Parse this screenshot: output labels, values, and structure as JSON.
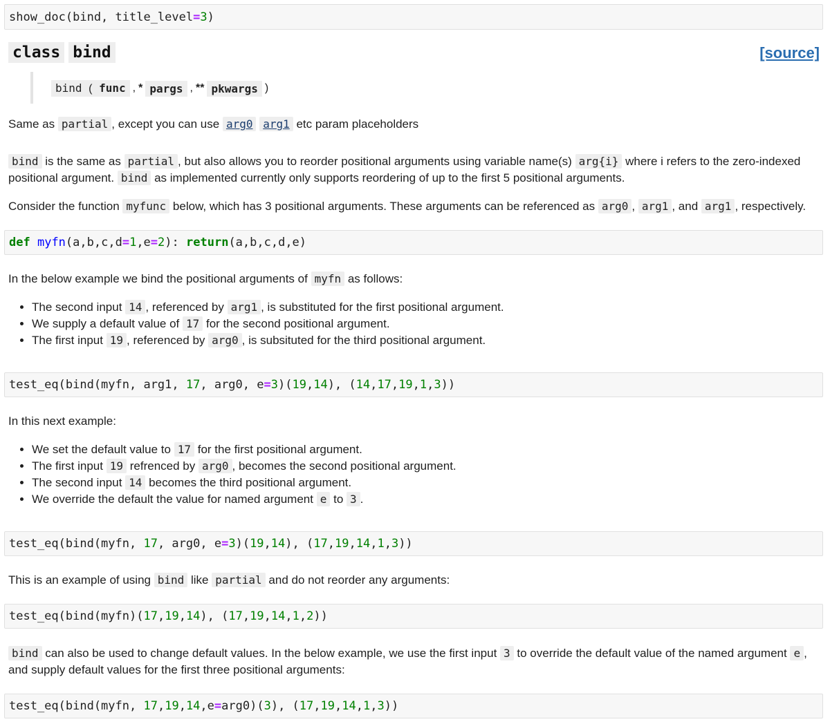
{
  "cells": {
    "show_doc": [
      "show_doc(bind, title_level",
      "=",
      "3",
      ")"
    ],
    "myfn_def": [
      "def",
      " ",
      "myfn",
      "(a,b,c,d",
      "=",
      "1",
      ",e",
      "=",
      "2",
      "): ",
      "return",
      "(a,b,c,d,e)"
    ],
    "test1": [
      "test_eq(bind(myfn, arg1, ",
      "17",
      ", arg0, e",
      "=",
      "3",
      ")(",
      "19",
      ",",
      "14",
      "), (",
      "14",
      ",",
      "17",
      ",",
      "19",
      ",",
      "1",
      ",",
      "3",
      "))"
    ],
    "test2": [
      "test_eq(bind(myfn, ",
      "17",
      ", arg0, e",
      "=",
      "3",
      ")(",
      "19",
      ",",
      "14",
      "), (",
      "17",
      ",",
      "19",
      ",",
      "14",
      ",",
      "1",
      ",",
      "3",
      "))"
    ],
    "test3": [
      "test_eq(bind(myfn)(",
      "17",
      ",",
      "19",
      ",",
      "14",
      "), (",
      "17",
      ",",
      "19",
      ",",
      "14",
      ",",
      "1",
      ",",
      "2",
      "))"
    ],
    "test4": [
      "test_eq(bind(myfn, ",
      "17",
      ",",
      "19",
      ",",
      "14",
      ",e",
      "=",
      "arg0)(",
      "3",
      "), (",
      "17",
      ",",
      "19",
      ",",
      "14",
      ",",
      "1",
      ",",
      "3",
      "))"
    ]
  },
  "heading": {
    "kw": "class",
    "name": "bind",
    "source_label": "[source]"
  },
  "signature": {
    "name": "bind",
    "open": "(",
    "p1": "func",
    "comma": ",",
    "star1": "*",
    "p2": "pargs",
    "star2": "**",
    "p3": "pkwargs",
    "close": ")"
  },
  "p1": {
    "t1": "Same as",
    "c1": "partial",
    "t2": ", except you can use",
    "c2": "arg0",
    "c3": "arg1",
    "t3": "etc param placeholders"
  },
  "p2": {
    "c1": "bind",
    "t1": "is the same as",
    "c2": "partial",
    "t2": ", but also allows you to reorder positional arguments using variable name(s)",
    "c3": "arg{i}",
    "t3": "where i refers to the zero-indexed positional argument.",
    "c4": "bind",
    "t4": "as implemented currently only supports reordering of up to the first 5 positional arguments."
  },
  "p3": {
    "t1": "Consider the function",
    "c1": "myfunc",
    "t2": "below, which has 3 positional arguments. These arguments can be referenced as",
    "c2": "arg0",
    "t3": ",",
    "c3": "arg1",
    "t4": ", and",
    "c4": "arg1",
    "t5": ", respectively."
  },
  "p4": {
    "t1": "In the below example we bind the positional arguments of",
    "c1": "myfn",
    "t2": "as follows:"
  },
  "list1": [
    {
      "t1": "The second input",
      "c1": "14",
      "t2": ", referenced by",
      "c2": "arg1",
      "t3": ", is substituted for the first positional argument."
    },
    {
      "t1": "We supply a default value of",
      "c1": "17",
      "t2": "for the second positional argument."
    },
    {
      "t1": "The first input",
      "c1": "19",
      "t2": ", referenced by",
      "c2": "arg0",
      "t3": ", is subsituted for the third positional argument."
    }
  ],
  "p5": {
    "t1": "In this next example:"
  },
  "list2": [
    {
      "t1": "We set the default value to",
      "c1": "17",
      "t2": "for the first positional argument."
    },
    {
      "t1": "The first input",
      "c1": "19",
      "t2": "refrenced by",
      "c2": "arg0",
      "t3": ", becomes the second positional argument."
    },
    {
      "t1": "The second input",
      "c1": "14",
      "t2": "becomes the third positional argument."
    },
    {
      "t1": "We override the default the value for named argument",
      "c1": "e",
      "t2": "to",
      "c2": "3",
      "t3": "."
    }
  ],
  "p6": {
    "t1": "This is an example of using",
    "c1": "bind",
    "t2": "like",
    "c2": "partial",
    "t3": "and do not reorder any arguments:"
  },
  "p7": {
    "c1": "bind",
    "t1": "can also be used to change default values. In the below example, we use the first input",
    "c2": "3",
    "t2": "to override the default value of the named argument",
    "c3": "e",
    "t3": ", and supply default values for the first three positional arguments:"
  }
}
